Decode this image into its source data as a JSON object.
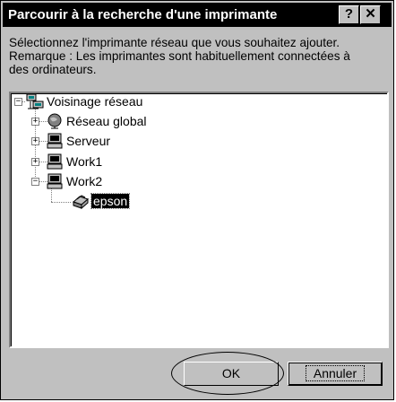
{
  "window": {
    "title": "Parcourir à la recherche d'une imprimante",
    "help_label": "?",
    "close_label": "✕"
  },
  "description": {
    "line1": "Sélectionnez l'imprimante réseau que vous souhaitez ajouter.",
    "line2": "Remarque : Les imprimantes sont habituellement connectées à",
    "line3": "des ordinateurs."
  },
  "tree": {
    "root": {
      "label": "Voisinage réseau",
      "icon": "network-neighborhood-icon",
      "expanded": true
    },
    "items": [
      {
        "label": "Réseau global",
        "icon": "globe-icon",
        "expanded": false
      },
      {
        "label": "Serveur",
        "icon": "computer-icon",
        "expanded": false
      },
      {
        "label": "Work1",
        "icon": "computer-icon",
        "expanded": false
      },
      {
        "label": "Work2",
        "icon": "computer-icon",
        "expanded": true
      }
    ],
    "printer": {
      "label": "epson",
      "icon": "printer-icon",
      "selected": true
    }
  },
  "buttons": {
    "ok_label": "OK",
    "cancel_label": "Annuler"
  }
}
